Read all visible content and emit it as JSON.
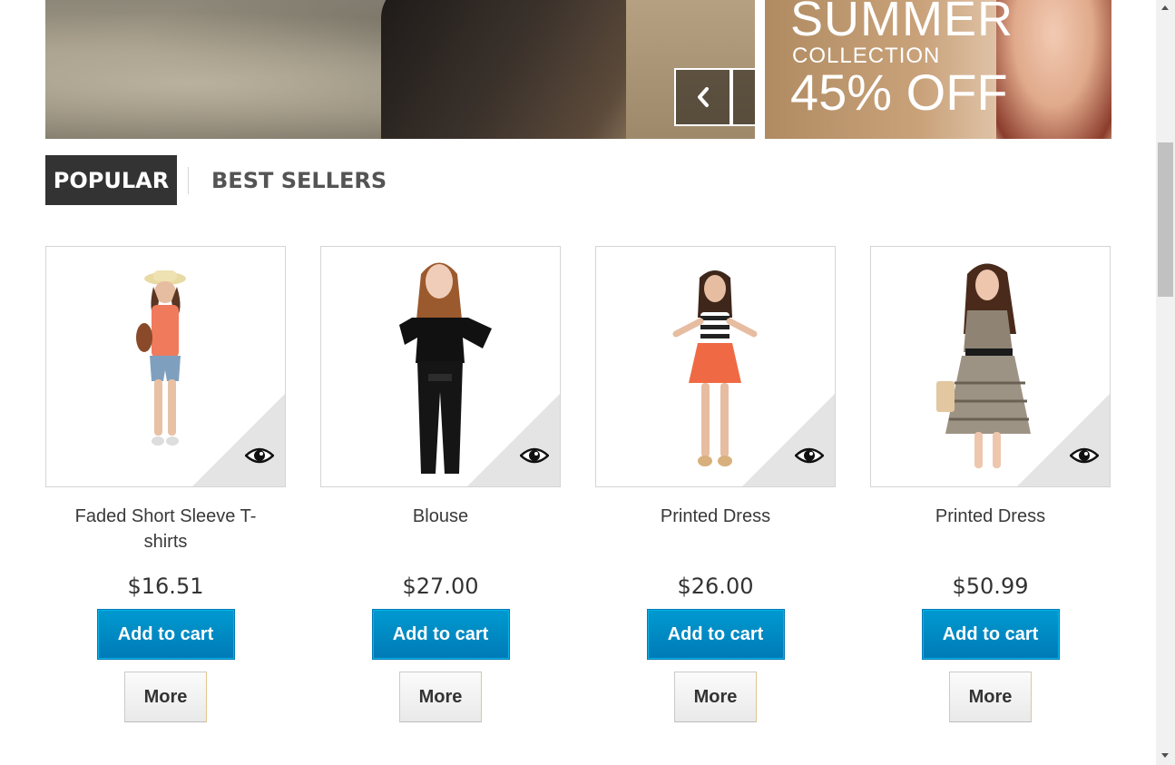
{
  "banner": {
    "side_line1": "SUMMER",
    "side_line2": "COLLECTION",
    "side_line3": "45% OFF"
  },
  "tabs": [
    {
      "label": "POPULAR",
      "active": true
    },
    {
      "label": "BEST SELLERS",
      "active": false
    }
  ],
  "products": [
    {
      "name": "Faded Short Sleeve T-shirts",
      "price": "$16.51",
      "add_label": "Add to cart",
      "more_label": "More"
    },
    {
      "name": "Blouse",
      "price": "$27.00",
      "add_label": "Add to cart",
      "more_label": "More"
    },
    {
      "name": "Printed Dress",
      "price": "$26.00",
      "add_label": "Add to cart",
      "more_label": "More"
    },
    {
      "name": "Printed Dress",
      "price": "$50.99",
      "add_label": "Add to cart",
      "more_label": "More"
    }
  ],
  "icons": {
    "prev": "chevron-left-icon",
    "next": "chevron-right-icon",
    "quick_view": "eye-icon"
  },
  "colors": {
    "add_to_cart": "#0088c6",
    "tab_active_bg": "#333333"
  }
}
